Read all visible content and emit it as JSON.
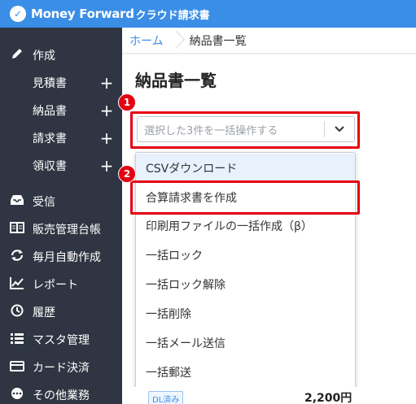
{
  "app": {
    "logo_mark": "✓",
    "brand": "Money Forward",
    "product": "クラウド請求書"
  },
  "sidebar": {
    "create": {
      "label": "作成",
      "icon": "pencil-icon"
    },
    "sub_items": [
      {
        "label": "見積書",
        "action": "+"
      },
      {
        "label": "納品書",
        "action": "+"
      },
      {
        "label": "請求書",
        "action": "+"
      },
      {
        "label": "領収書",
        "action": "+"
      }
    ],
    "items": [
      {
        "label": "受信",
        "icon": "inbox-icon"
      },
      {
        "label": "販売管理台帳",
        "icon": "ledger-icon"
      },
      {
        "label": "毎月自動作成",
        "icon": "refresh-icon"
      },
      {
        "label": "レポート",
        "icon": "chart-icon"
      },
      {
        "label": "履歴",
        "icon": "history-icon"
      },
      {
        "label": "マスタ管理",
        "icon": "list-icon"
      },
      {
        "label": "カード決済",
        "icon": "card-icon"
      },
      {
        "label": "その他業務",
        "icon": "more-icon"
      }
    ]
  },
  "breadcrumb": {
    "home": "ホーム",
    "current": "納品書一覧"
  },
  "page": {
    "title": "納品書一覧"
  },
  "bulk": {
    "placeholder": "選択した3件を一括操作する"
  },
  "annotations": {
    "step1": "1",
    "step2": "2",
    "highlight_color": "#e40012"
  },
  "dropdown": {
    "options": [
      "CSVダウンロード",
      "合算請求書を作成",
      "印刷用ファイルの一括作成（β）",
      "一括ロック",
      "一括ロック解除",
      "一括削除",
      "一括メール送信",
      "一括郵送"
    ]
  },
  "row": {
    "tag": "DL済み",
    "amount": "2,200円"
  },
  "colors": {
    "brand": "#3a8ee6",
    "sidebar": "#2f3542"
  }
}
